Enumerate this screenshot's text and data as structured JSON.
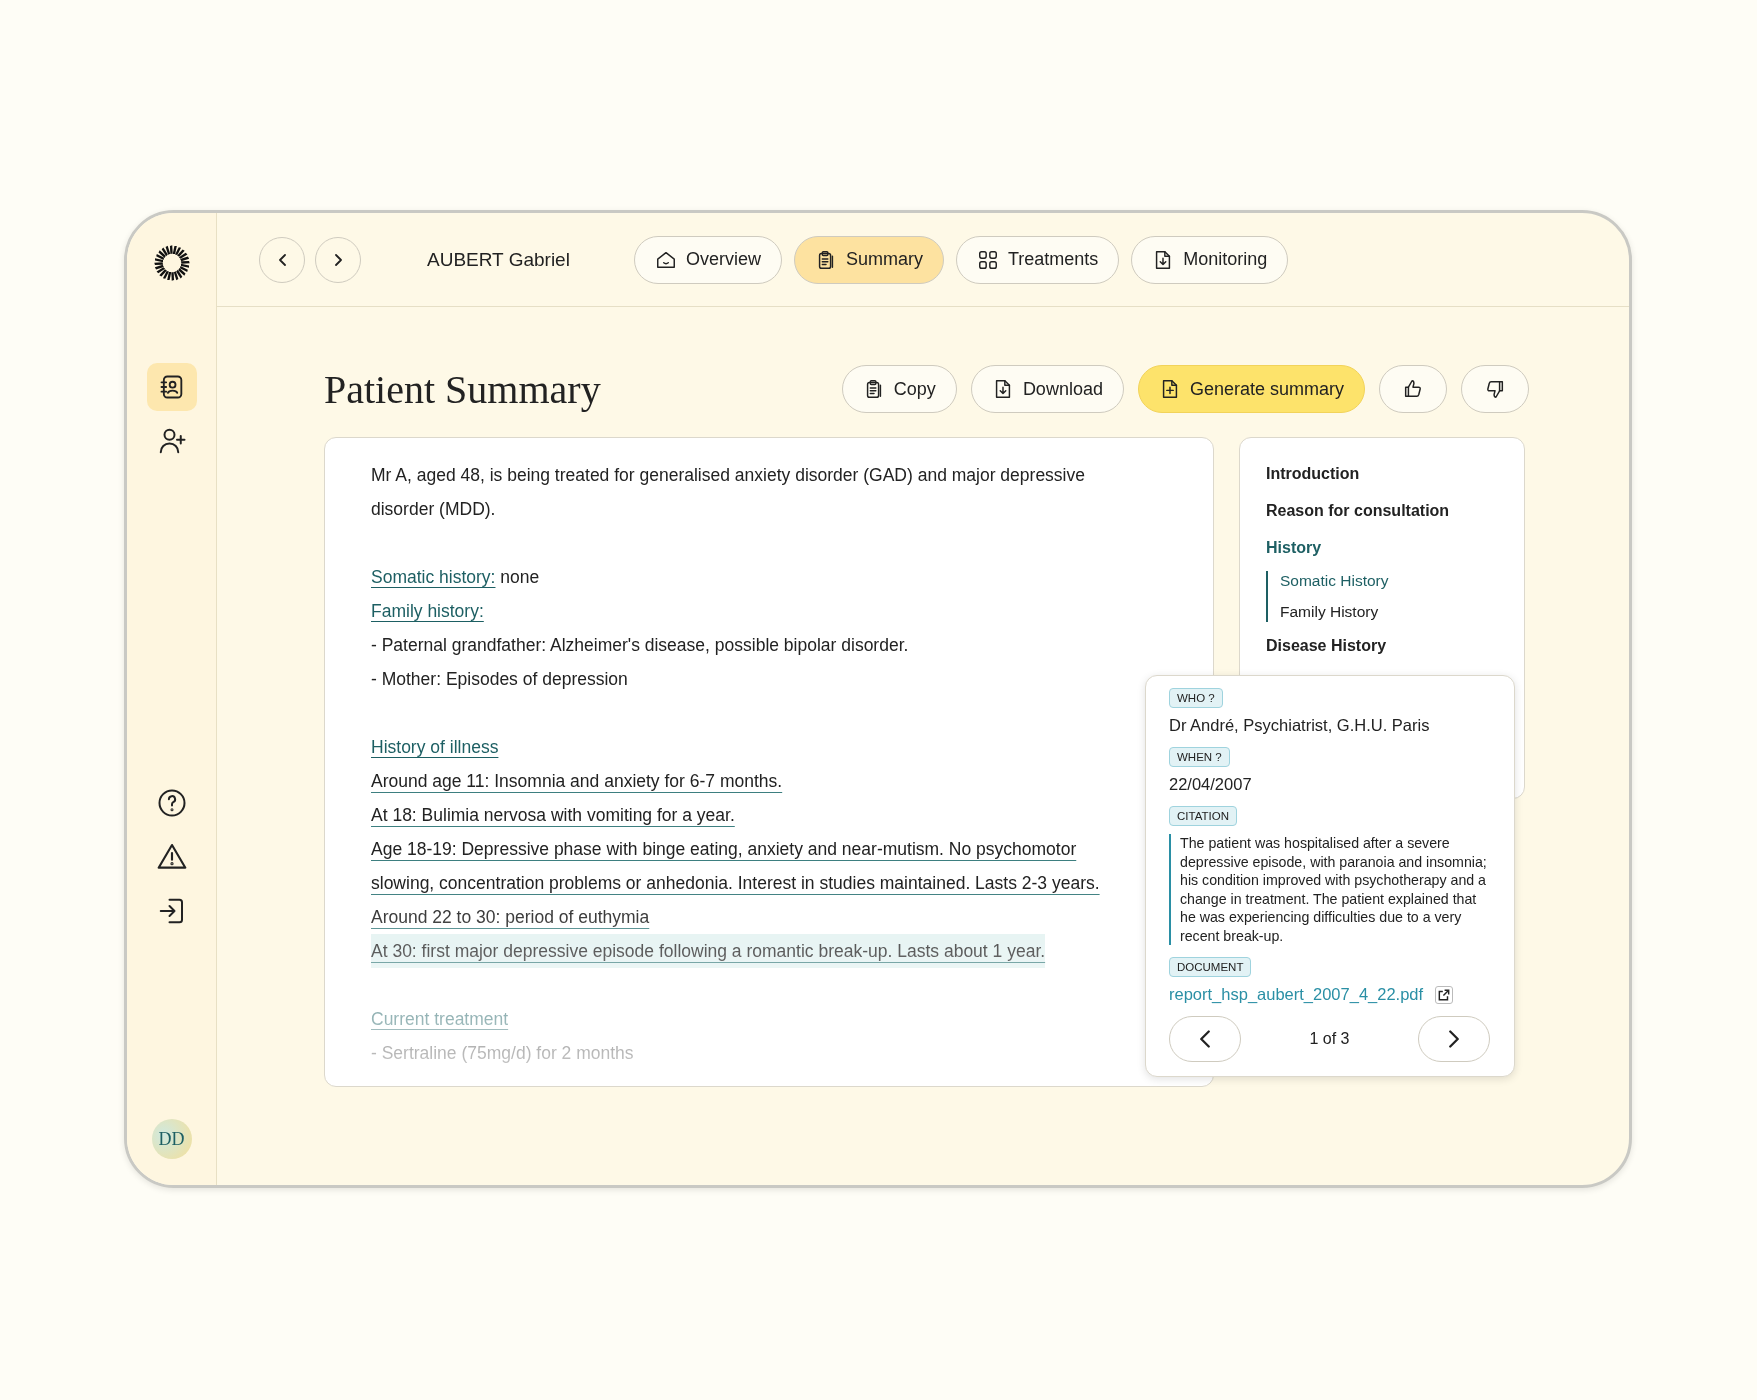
{
  "sidebar": {
    "items": [
      {
        "kind": "contacts",
        "selected": true
      },
      {
        "kind": "add-user",
        "selected": false
      }
    ],
    "bottom_items": [
      {
        "kind": "help"
      },
      {
        "kind": "warning"
      },
      {
        "kind": "logout"
      }
    ],
    "avatar": "DD"
  },
  "topbar": {
    "patient": "AUBERT Gabriel",
    "tabs": [
      {
        "label": "Overview",
        "kind": "home",
        "selected": false
      },
      {
        "label": "Summary",
        "kind": "clipboard",
        "selected": true
      },
      {
        "label": "Treatments",
        "kind": "grid",
        "selected": false
      },
      {
        "label": "Monitoring",
        "kind": "file",
        "selected": false
      }
    ]
  },
  "page": {
    "title": "Patient Summary",
    "actions": [
      {
        "label": "Copy",
        "kind": "copy",
        "primary": false
      },
      {
        "label": "Download",
        "kind": "download",
        "primary": false
      },
      {
        "label": "Generate summary",
        "kind": "generate",
        "primary": true
      },
      {
        "kind": "like",
        "primary": false
      },
      {
        "kind": "dislike",
        "primary": false
      }
    ]
  },
  "summary": {
    "sections": [
      {
        "lines": [
          {
            "kind": "text",
            "text": "Mr A, aged 48, is being treated for generalised anxiety disorder (GAD) and major depressive disorder (MDD)."
          }
        ]
      },
      {
        "lines": [
          {
            "kind": "field",
            "label": "Somatic history:",
            "value": "none"
          },
          {
            "kind": "heading",
            "text": "Family history:"
          },
          {
            "kind": "text",
            "text": "- Paternal grandfather: Alzheimer's disease, possible bipolar disorder."
          },
          {
            "kind": "text",
            "text": "- Mother: Episodes of depression"
          }
        ]
      },
      {
        "lines": [
          {
            "kind": "heading",
            "text": "History of illness"
          },
          {
            "kind": "event",
            "text": "Around age 11: Insomnia and anxiety for 6-7 months.",
            "highlighted": false
          },
          {
            "kind": "event",
            "text": "At 18: Bulimia nervosa with vomiting for a year.",
            "highlighted": false
          },
          {
            "kind": "event",
            "text": "Age 18-19: Depressive phase with binge eating, anxiety and near-mutism. No psychomotor slowing, concentration problems or anhedonia. Interest in studies maintained. Lasts 2-3 years.",
            "highlighted": false
          },
          {
            "kind": "event",
            "text": "Around 22 to 30: period of euthymia",
            "highlighted": false
          },
          {
            "kind": "event",
            "text": "At 30: first major depressive episode following a romantic break-up. Lasts about 1 year.",
            "highlighted": true
          }
        ]
      },
      {
        "lines": [
          {
            "kind": "heading",
            "text": "Current treatment"
          },
          {
            "kind": "text",
            "text": "- Sertraline (75mg/d) for 2 months"
          }
        ]
      }
    ]
  },
  "toc": [
    {
      "label": "Introduction",
      "selected": false
    },
    {
      "label": "Reason for consultation",
      "selected": false
    },
    {
      "label": "History",
      "selected": true,
      "children": [
        {
          "label": "Somatic History",
          "selected": true
        },
        {
          "label": "Family History",
          "selected": false
        }
      ]
    },
    {
      "label": "Disease History",
      "selected": false
    }
  ],
  "source_popover": {
    "fields": [
      {
        "tag": "WHO ?",
        "kind": "text",
        "value": "Dr André, Psychiatrist, G.H.U. Paris"
      },
      {
        "tag": "WHEN ?",
        "kind": "text",
        "value": "22/04/2007"
      },
      {
        "tag": "CITATION",
        "kind": "quote",
        "value": "The patient was hospitalised after a severe depressive episode, with paranoia and insomnia; his condition improved with psychotherapy and a change in treatment. The patient explained that he was experiencing difficulties due to a very recent break-up."
      },
      {
        "tag": "DOCUMENT",
        "kind": "link",
        "value": "report_hsp_aubert_2007_4_22.pdf"
      }
    ],
    "pager": "1 of 3"
  }
}
